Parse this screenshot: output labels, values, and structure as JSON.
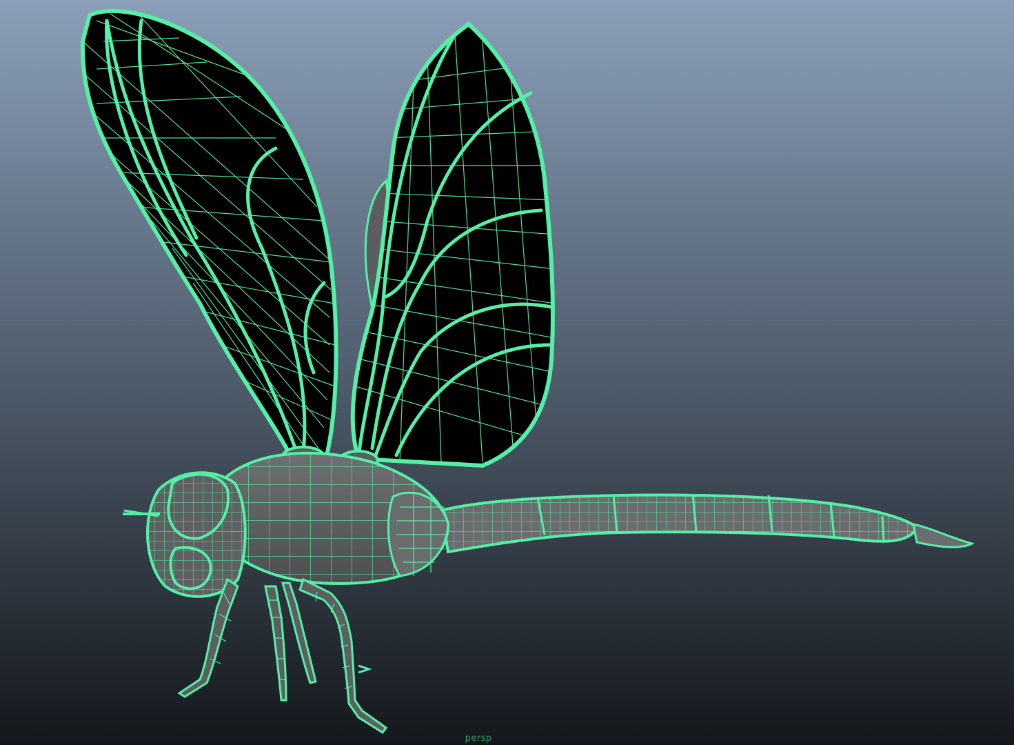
{
  "viewport": {
    "camera_label": "persp",
    "background_top": "#8a9fb8",
    "background_bottom": "#14171b"
  },
  "model": {
    "wire_color": "#55f0a8",
    "surface_color": "#646668",
    "wing_fill": "#000000",
    "icon": "dragonfly-wireframe"
  }
}
